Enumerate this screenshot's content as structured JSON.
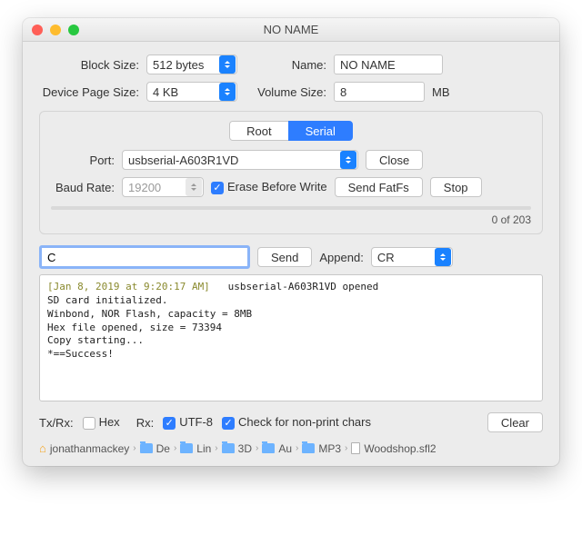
{
  "window": {
    "title": "NO NAME"
  },
  "form": {
    "block_size_label": "Block Size:",
    "block_size_value": "512 bytes",
    "name_label": "Name:",
    "name_value": "NO NAME",
    "page_size_label": "Device Page Size:",
    "page_size_value": "4 KB",
    "volume_size_label": "Volume Size:",
    "volume_size_value": "8",
    "volume_size_unit": "MB"
  },
  "serial": {
    "tab_root": "Root",
    "tab_serial": "Serial",
    "port_label": "Port:",
    "port_value": "usbserial-A603R1VD",
    "close_btn": "Close",
    "baud_label": "Baud Rate:",
    "baud_value": "19200",
    "erase_label": "Erase Before Write",
    "send_fatfs_btn": "Send FatFs",
    "stop_btn": "Stop",
    "progress_text": "0 of 203"
  },
  "cmd": {
    "input_value": "C",
    "send_btn": "Send",
    "append_label": "Append:",
    "append_value": "CR"
  },
  "terminal": {
    "timestamp": "[Jan 8, 2019 at 9:20:17 AM]",
    "line1_rest": "   usbserial-A603R1VD opened",
    "line2": "SD card initialized.",
    "line3": "Winbond, NOR Flash, capacity = 8MB",
    "line4": "Hex file opened, size = 73394",
    "line5": "Copy starting...",
    "line6": "*==Success!"
  },
  "bottom": {
    "txrx_label": "Tx/Rx:",
    "hex_label": "Hex",
    "rx_label": "Rx:",
    "utf8_label": "UTF-8",
    "nonprint_label": "Check for non-print chars",
    "clear_btn": "Clear"
  },
  "crumbs": {
    "c0": "jonathanmackey",
    "c1": "De",
    "c2": "Lin",
    "c3": "3D",
    "c4": "Au",
    "c5": "MP3",
    "c6": "Woodshop.sfl2"
  }
}
